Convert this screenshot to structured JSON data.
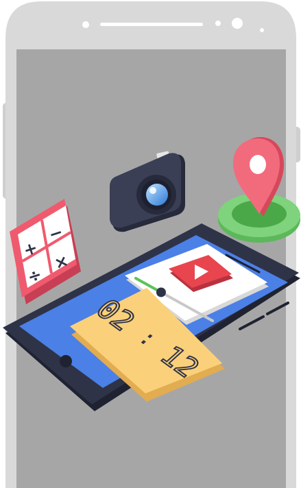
{
  "scene": {
    "clock": {
      "hours": "02",
      "separator": ":",
      "minutes": "12"
    },
    "calculator_symbols": {
      "plus": "+",
      "minus": "−",
      "divide": "÷",
      "times": "×"
    },
    "media_player": {
      "progress": 0.33
    }
  },
  "colors": {
    "phone_frame": "#d9d9d9",
    "phone_screen": "#a6a6a6",
    "tablet_body": "#2f3347",
    "tablet_screen": "#4b80e6",
    "calculator": "#f05a6e",
    "clock": "#fbd07a",
    "pin": "#ee5b6e",
    "pin_base": "#7ed37c",
    "play_button": "#e8454f",
    "slider_fill": "#5cc35c"
  },
  "icons": [
    "calculator-icon",
    "camera-icon",
    "map-pin-icon",
    "play-icon",
    "clock-icon"
  ]
}
